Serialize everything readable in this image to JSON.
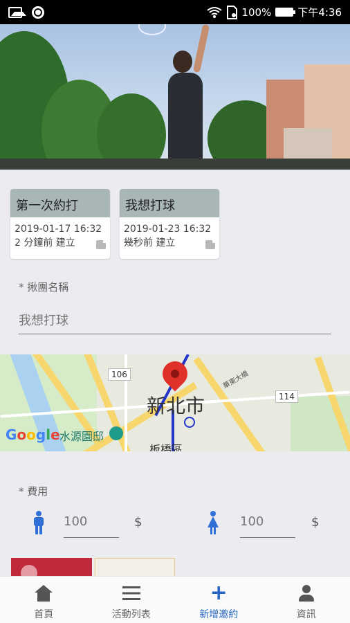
{
  "status_bar": {
    "battery": "100%",
    "time": "下午4:36"
  },
  "cards": [
    {
      "title": "第一次約打",
      "datetime": "2019-01-17 16:32",
      "created": "2 分鐘前 建立"
    },
    {
      "title": "我想打球",
      "datetime": "2019-01-23 16:32",
      "created": "幾秒前 建立"
    }
  ],
  "form": {
    "group_name_label": "* 揪團名稱",
    "group_name_value": "我想打球",
    "fee_label": "* 費用",
    "male_fee": "100",
    "female_fee": "100",
    "currency": "$"
  },
  "map": {
    "city": "新北市",
    "district": "板橋區",
    "road_106": "106",
    "road_114": "114",
    "small_road": "華東大橋",
    "poi": "水源園邸",
    "logo": "Google"
  },
  "nav": {
    "items": [
      {
        "label": "首頁",
        "icon": "home-icon"
      },
      {
        "label": "活動列表",
        "icon": "list-icon"
      },
      {
        "label": "新增邀約",
        "icon": "plus-icon"
      },
      {
        "label": "資訊",
        "icon": "person-icon"
      }
    ],
    "active_color": "#2565c3"
  },
  "colors": {
    "card_header": "#a9b6b8",
    "accent": "#2565c3",
    "gender_icon": "#2f6fd6"
  }
}
